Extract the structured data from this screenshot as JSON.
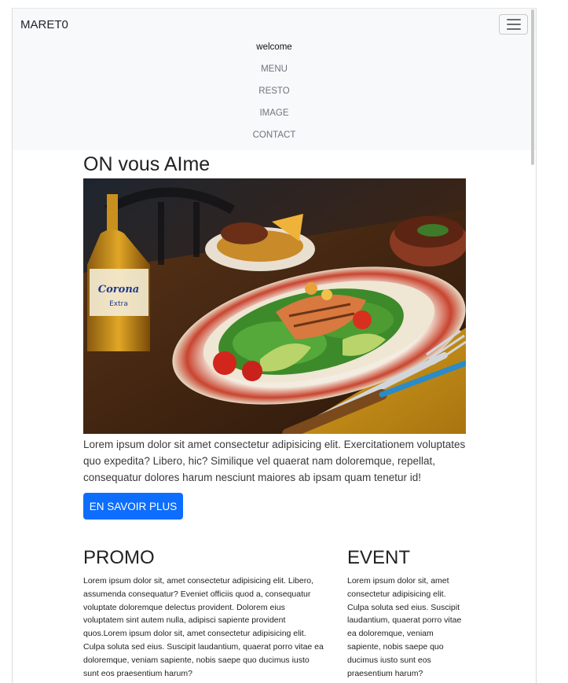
{
  "navbar": {
    "brand": "MARET0",
    "items": [
      {
        "label": "welcome",
        "active": true
      },
      {
        "label": "MENU",
        "active": false
      },
      {
        "label": "RESTO",
        "active": false
      },
      {
        "label": "IMAGE",
        "active": false
      },
      {
        "label": "CONTACT",
        "active": false
      }
    ],
    "toggler_icon": "hamburger-icon"
  },
  "hero": {
    "title": "ON vous AIme",
    "image_subject": "grilled salmon salad plate with Corona beer bottle on a restaurant table",
    "bottle_label": "Corona",
    "bottle_sublabel": "Extra",
    "intro": "Lorem ipsum dolor sit amet consectetur adipisicing elit. Exercitationem voluptates quo expedita? Libero, hic? Similique vel quaerat nam doloremque, repellat, consequatur dolores harum nesciunt maiores ab ipsam quam tenetur id!",
    "cta_label": "EN SAVOIR PLUS"
  },
  "promo": {
    "title": "PROMO",
    "text": "Lorem ipsum dolor sit, amet consectetur adipisicing elit. Libero, assumenda consequatur? Eveniet officiis quod a, consequatur voluptate doloremque delectus provident. Dolorem eius voluptatem sint autem nulla, adipisci sapiente provident quos.Lorem ipsum dolor sit, amet consectetur adipisicing elit. Culpa soluta sed eius. Suscipit laudantium, quaerat porro vitae ea doloremque, veniam sapiente, nobis saepe quo ducimus iusto sunt eos praesentium harum?"
  },
  "event": {
    "title": "EVENT",
    "text": "Lorem ipsum dolor sit, amet consectetur adipisicing elit. Culpa soluta sed eius. Suscipit laudantium, quaerat porro vitae ea doloremque, veniam sapiente, nobis saepe quo ducimus iusto sunt eos praesentium harum?"
  },
  "colors": {
    "navbar_bg": "#f8f9fa",
    "primary_button": "#0d6efd",
    "text": "#212529",
    "nav_muted": "#6c757d"
  }
}
